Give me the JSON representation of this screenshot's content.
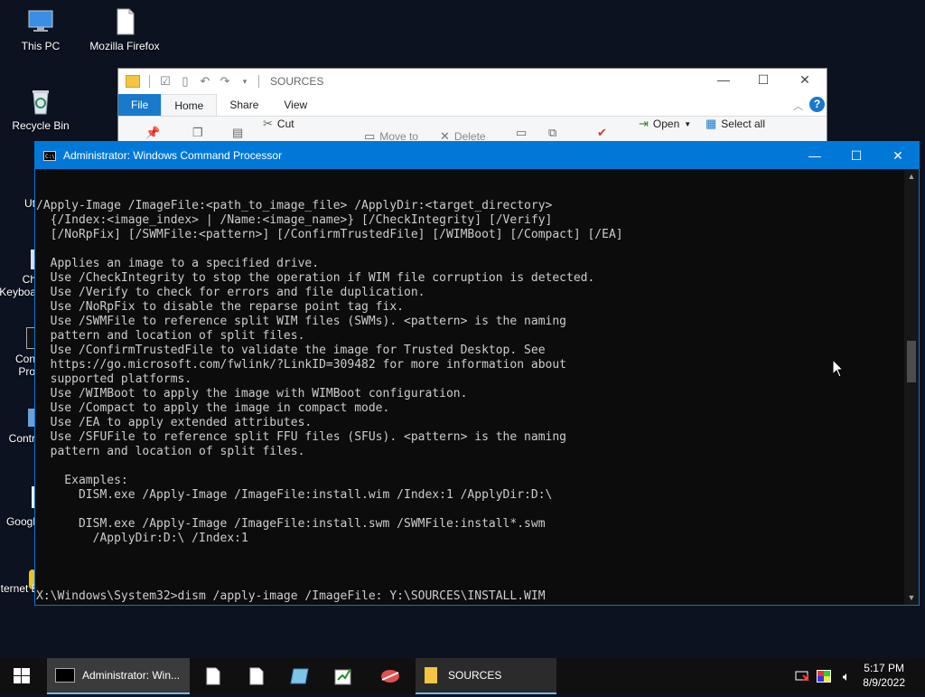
{
  "desktop": {
    "icons": [
      {
        "label": "This PC",
        "icon": "this-pc-icon"
      },
      {
        "label": "Mozilla Firefox",
        "icon": "file-icon"
      },
      {
        "label": "Recycle Bin",
        "icon": "recycle-bin-icon"
      },
      {
        "label": "Ut",
        "icon": "app-icon"
      },
      {
        "label": "Ch",
        "icon": "app-icon"
      },
      {
        "label": "Keyboa",
        "icon": "app-icon"
      },
      {
        "label": "Con",
        "icon": "app-icon"
      },
      {
        "label": "Pro",
        "icon": "app-icon"
      },
      {
        "label": "Contr",
        "icon": "app-icon"
      },
      {
        "label": "Googl",
        "icon": "app-icon"
      },
      {
        "label": "Internet Explorer",
        "icon": "ie-icon"
      }
    ]
  },
  "explorer": {
    "title": "SOURCES",
    "tabs": [
      "File",
      "Home",
      "Share",
      "View"
    ],
    "ribbon": {
      "cut": "Cut",
      "move_to": "Move to",
      "delete": "Delete",
      "open": "Open",
      "select_all": "Select all"
    },
    "controls": {
      "minimize": "—",
      "maximize": "☐",
      "close": "✕",
      "help": "?"
    }
  },
  "cmd": {
    "title": "Administrator: Windows Command Processor",
    "controls": {
      "minimize": "—",
      "maximize": "☐",
      "close": "✕"
    },
    "lines": [
      "/Apply-Image /ImageFile:<path_to_image_file> /ApplyDir:<target_directory>",
      "  {/Index:<image_index> | /Name:<image_name>} [/CheckIntegrity] [/Verify]",
      "  [/NoRpFix] [/SWMFile:<pattern>] [/ConfirmTrustedFile] [/WIMBoot] [/Compact] [/EA]",
      "",
      "  Applies an image to a specified drive.",
      "  Use /CheckIntegrity to stop the operation if WIM file corruption is detected.",
      "  Use /Verify to check for errors and file duplication.",
      "  Use /NoRpFix to disable the reparse point tag fix.",
      "  Use /SWMFile to reference split WIM files (SWMs). <pattern> is the naming",
      "  pattern and location of split files.",
      "  Use /ConfirmTrustedFile to validate the image for Trusted Desktop. See",
      "  https://go.microsoft.com/fwlink/?LinkID=309482 for more information about",
      "  supported platforms.",
      "  Use /WIMBoot to apply the image with WIMBoot configuration.",
      "  Use /Compact to apply the image in compact mode.",
      "  Use /EA to apply extended attributes.",
      "  Use /SFUFile to reference split FFU files (SFUs). <pattern> is the naming",
      "  pattern and location of split files.",
      "",
      "    Examples:",
      "      DISM.exe /Apply-Image /ImageFile:install.wim /Index:1 /ApplyDir:D:\\",
      "",
      "      DISM.exe /Apply-Image /ImageFile:install.swm /SWMFile:install*.swm",
      "        /ApplyDir:D:\\ /Index:1",
      "",
      "",
      "",
      "X:\\Windows\\System32>dism /apply-image /ImageFile: Y:\\SOURCES\\INSTALL.WIM"
    ]
  },
  "taskbar": {
    "cmd_label": "Administrator: Win...",
    "sources_label": "SOURCES",
    "time": "5:17 PM",
    "date": "8/9/2022"
  },
  "colors": {
    "accent": "#0078d7",
    "console_text": "#cccccc",
    "console_bg": "#0c0c0c"
  }
}
